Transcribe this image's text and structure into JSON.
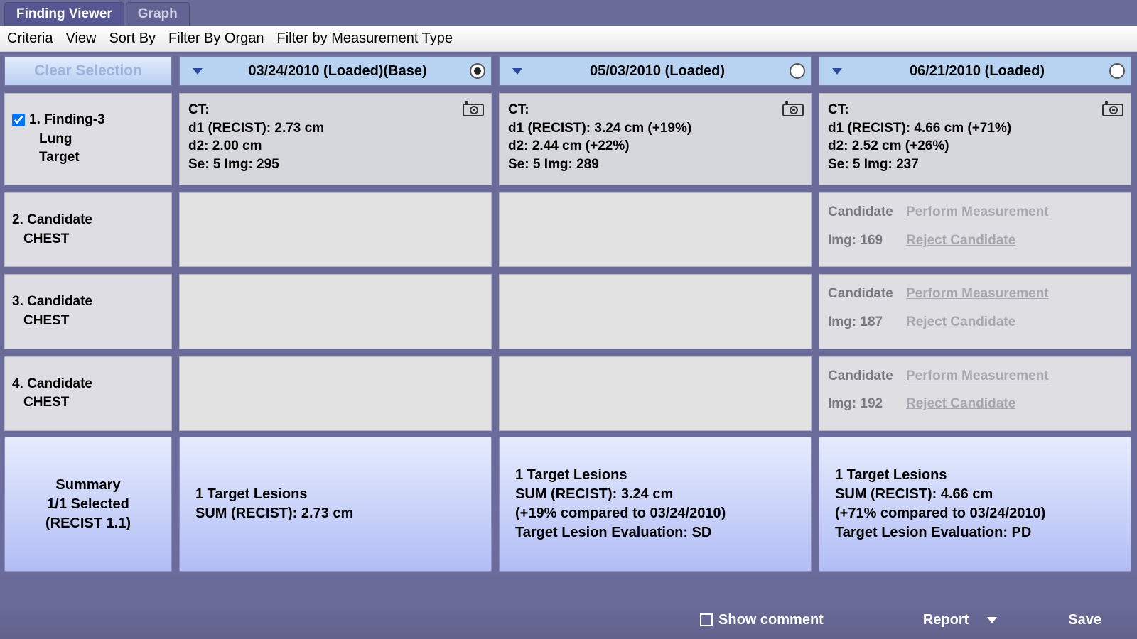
{
  "tabs": {
    "viewer": "Finding Viewer",
    "graph": "Graph"
  },
  "toolbar": {
    "criteria": "Criteria",
    "view": "View",
    "sortby": "Sort By",
    "filter_organ": "Filter By Organ",
    "filter_meas": "Filter by Measurement Type"
  },
  "headers": {
    "clear": "Clear Selection",
    "col1": "03/24/2010  (Loaded)(Base)",
    "col2": "05/03/2010  (Loaded)",
    "col3": "06/21/2010  (Loaded)"
  },
  "rows": [
    {
      "label_line1": "1. Finding-3",
      "label_line2": "Lung",
      "label_line3": "Target",
      "checked": true,
      "cells": [
        {
          "l1": "CT:",
          "l2": "d1 (RECIST): 2.73 cm",
          "l3": "d2: 2.00 cm",
          "l4": "Se: 5  Img: 295",
          "camera": true
        },
        {
          "l1": "CT:",
          "l2": "d1 (RECIST): 3.24 cm (+19%)",
          "l3": "d2: 2.44 cm (+22%)",
          "l4": "Se: 5  Img: 289",
          "camera": true
        },
        {
          "l1": "CT:",
          "l2": "d1 (RECIST): 4.66 cm (+71%)",
          "l3": "d2: 2.52 cm (+26%)",
          "l4": "Se: 5  Img: 237",
          "camera": true
        }
      ]
    },
    {
      "label_line1": "2. Candidate",
      "label_line2": "CHEST",
      "cells": [
        {
          "empty": true
        },
        {
          "empty": true
        },
        {
          "candidate": true,
          "cand_label": "Candidate",
          "perform": "Perform Measurement",
          "img": "Img: 169",
          "reject": "Reject Candidate"
        }
      ]
    },
    {
      "label_line1": "3. Candidate",
      "label_line2": "CHEST",
      "cells": [
        {
          "empty": true
        },
        {
          "empty": true
        },
        {
          "candidate": true,
          "cand_label": "Candidate",
          "perform": "Perform Measurement",
          "img": "Img: 187",
          "reject": "Reject Candidate"
        }
      ]
    },
    {
      "label_line1": "4. Candidate",
      "label_line2": "CHEST",
      "cells": [
        {
          "empty": true
        },
        {
          "empty": true
        },
        {
          "candidate": true,
          "cand_label": "Candidate",
          "perform": "Perform Measurement",
          "img": "Img: 192",
          "reject": "Reject Candidate"
        }
      ]
    }
  ],
  "summary": {
    "left_l1": "Summary",
    "left_l2": "1/1 Selected",
    "left_l3": "(RECIST 1.1)",
    "c1_l1": "1 Target Lesions",
    "c1_l2": "SUM (RECIST): 2.73 cm",
    "c2_l1": "1 Target Lesions",
    "c2_l2": "SUM (RECIST): 3.24 cm",
    "c2_l3": "(+19% compared to 03/24/2010)",
    "c2_l4": "Target Lesion Evaluation: SD",
    "c3_l1": "1 Target Lesions",
    "c3_l2": "SUM (RECIST): 4.66 cm",
    "c3_l3": "(+71% compared to 03/24/2010)",
    "c3_l4": "Target Lesion Evaluation: PD"
  },
  "bottom": {
    "show_comment": "Show comment",
    "report": "Report",
    "save": "Save"
  }
}
